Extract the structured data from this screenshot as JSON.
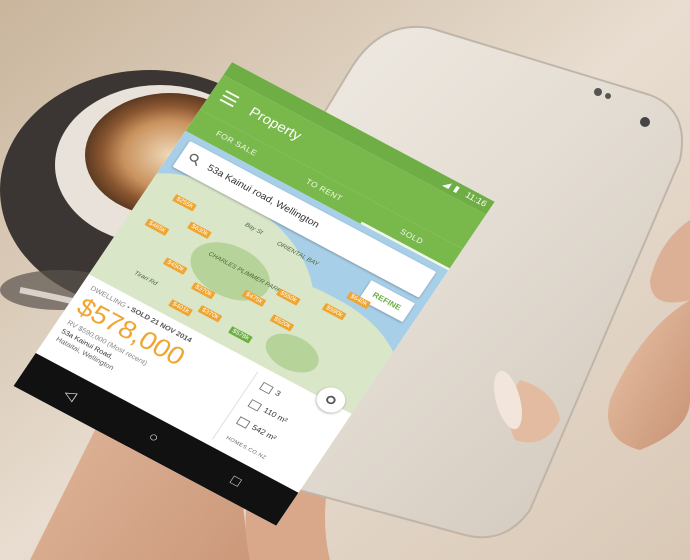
{
  "app": {
    "title": "Property",
    "status_time": "11:16",
    "status_icons": "◢ ▮"
  },
  "tabs": [
    {
      "label": "FOR SALE",
      "active": false
    },
    {
      "label": "TO RENT",
      "active": false
    },
    {
      "label": "SOLD",
      "active": true
    }
  ],
  "search": {
    "value": "53a Kainui road, Wellington"
  },
  "refine_label": "REFINE",
  "map": {
    "labels": [
      "CHARLES PLIMMER PARK",
      "Tirari Rd",
      "Bay St",
      "ORIENTAL BAY"
    ],
    "pins": [
      {
        "label": "$255k"
      },
      {
        "label": "$630k"
      },
      {
        "label": "$465k"
      },
      {
        "label": "$450k"
      },
      {
        "label": "$370k"
      },
      {
        "label": "$475k"
      },
      {
        "label": "$550k"
      },
      {
        "label": "$520k"
      },
      {
        "label": "$590k"
      },
      {
        "label": "$370k"
      },
      {
        "label": "$640k"
      },
      {
        "label": "$401k"
      },
      {
        "label": "$578k",
        "selected": true
      }
    ]
  },
  "detail": {
    "type": "DWELLING",
    "sold_date": "SOLD 21 NOV 2014",
    "price": "$578,000",
    "rv": "RV $590,000 (Most recent)",
    "address": "53a Kainui Road,",
    "suburb": "Hataitai, Wellington",
    "bedrooms": "3",
    "floor_area": "110 m²",
    "land_area": "542 m²",
    "brand": "HOMES.CO.NZ"
  },
  "nav": {
    "back": "◁",
    "home": "○",
    "recent": "□"
  },
  "colors": {
    "brand_green": "#79b84b",
    "pin_orange": "#f0a531",
    "water": "#a8cfe8"
  }
}
